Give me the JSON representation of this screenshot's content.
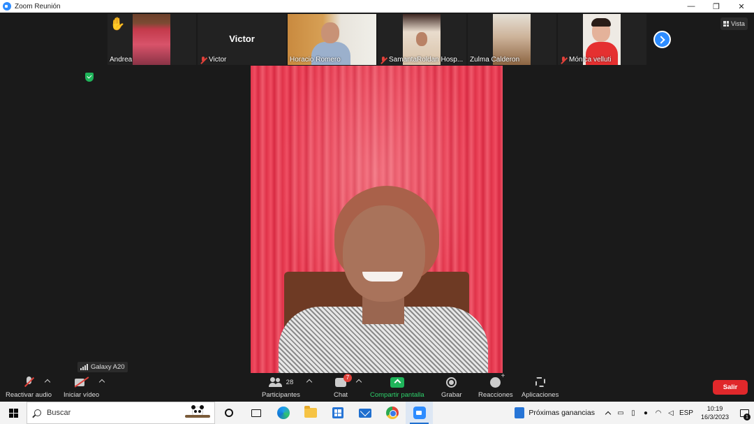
{
  "window": {
    "title": "Zoom Reunión",
    "minimize": "—",
    "restore": "❐",
    "close": "✕"
  },
  "view_button": {
    "label": "Vista"
  },
  "participants_strip": [
    {
      "name": "Andrea",
      "muted": false,
      "hand_raised": true
    },
    {
      "name": "Victor",
      "muted": true,
      "video_off": true,
      "display_name_center": "Victor"
    },
    {
      "name": "Horacio Romero",
      "muted": false
    },
    {
      "name": "SamantaRoldan Hosp...",
      "muted": true
    },
    {
      "name": "Zulma Calderon",
      "muted": false
    },
    {
      "name": "Mónica velluti",
      "muted": true
    }
  ],
  "device_label": "Galaxy A20",
  "toolbar": {
    "audio_label": "Reactivar audio",
    "video_label": "Iniciar vídeo",
    "participants_label": "Participantes",
    "participants_count": "28",
    "chat_label": "Chat",
    "chat_badge": "7",
    "share_label": "Compartir pantalla",
    "record_label": "Grabar",
    "reactions_label": "Reacciones",
    "apps_label": "Aplicaciones",
    "leave_label": "Salir"
  },
  "taskbar": {
    "search_placeholder": "Buscar",
    "news_label": "Próximas ganancias",
    "language": "ESP",
    "time": "10:19",
    "date": "16/3/2023",
    "notification_count": "1"
  },
  "colors": {
    "zoom_blue": "#2d8cff",
    "leave_red": "#e0282b",
    "share_green": "#1fb45a",
    "muted_red": "#e0413a"
  }
}
